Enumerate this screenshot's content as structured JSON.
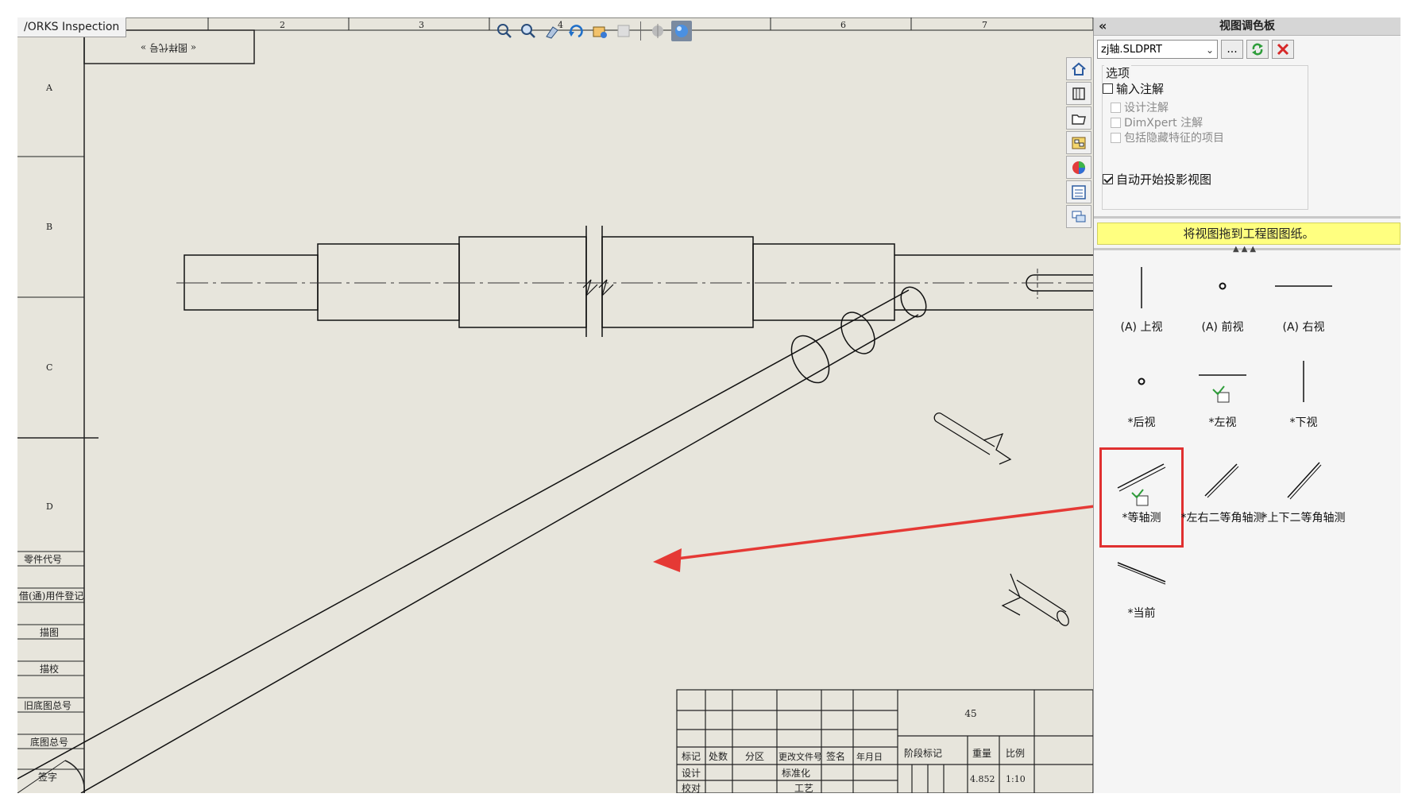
{
  "window": {
    "tab_label": "/ORKS Inspection"
  },
  "sheet": {
    "zone_numbers": [
      "2",
      "3",
      "4",
      "6",
      "7"
    ],
    "zone_letters": [
      "A",
      "B",
      "C",
      "D"
    ],
    "upside_title": "« 图样代号 »",
    "left_strip_labels": [
      "零件代号",
      "借(通)用件登记",
      "描图",
      "描校",
      "旧底图总号",
      "底图总号",
      "签字"
    ],
    "title_block": {
      "material": "45",
      "headers": [
        "标记",
        "处数",
        "分区",
        "更改文件号",
        "签名",
        "年月日",
        "阶段标记",
        "重量",
        "比例"
      ],
      "row_design": "设计",
      "row_std": "标准化",
      "row_check": "校对",
      "row_process": "工艺",
      "weight": "4.852",
      "scale": "1:10"
    }
  },
  "heads_up_toolbar": {
    "items": [
      "zoom-to-fit-icon",
      "zoom-area-icon",
      "previous-view-icon",
      "rotate-icon",
      "display-style-icon",
      "hide-show-icon",
      "scene-icon",
      "appearance-icon"
    ]
  },
  "task_tabs": [
    "home-icon",
    "design-library-icon",
    "file-explorer-icon",
    "view-palette-icon",
    "appearances-icon",
    "custom-properties-icon",
    "forum-icon"
  ],
  "panel": {
    "title": "视图调色板",
    "file_name": "zj轴.SLDPRT",
    "browse_label": "...",
    "options_title": "选项",
    "import_annotations": "输入注解",
    "design_annotations": "设计注解",
    "dimxpert_annotations": "DimXpert 注解",
    "hidden_features": "包括隐藏特征的项目",
    "auto_projected": "自动开始投影视图",
    "hint": "将视图拖到工程图图纸。",
    "views": [
      {
        "label": "(A) 上视"
      },
      {
        "label": "(A) 前视"
      },
      {
        "label": "(A) 右视"
      },
      {
        "label": "*后视"
      },
      {
        "label": "*左视"
      },
      {
        "label": "*下视"
      },
      {
        "label": "*等轴测"
      },
      {
        "label": "*左右二等角轴测"
      },
      {
        "label": "*上下二等角轴测"
      },
      {
        "label": "*当前"
      }
    ]
  },
  "colors": {
    "sheet_bg": "#e7e5dc",
    "hint_bg": "#ffff80",
    "highlight": "#e03030",
    "arrow": "#e53935"
  }
}
